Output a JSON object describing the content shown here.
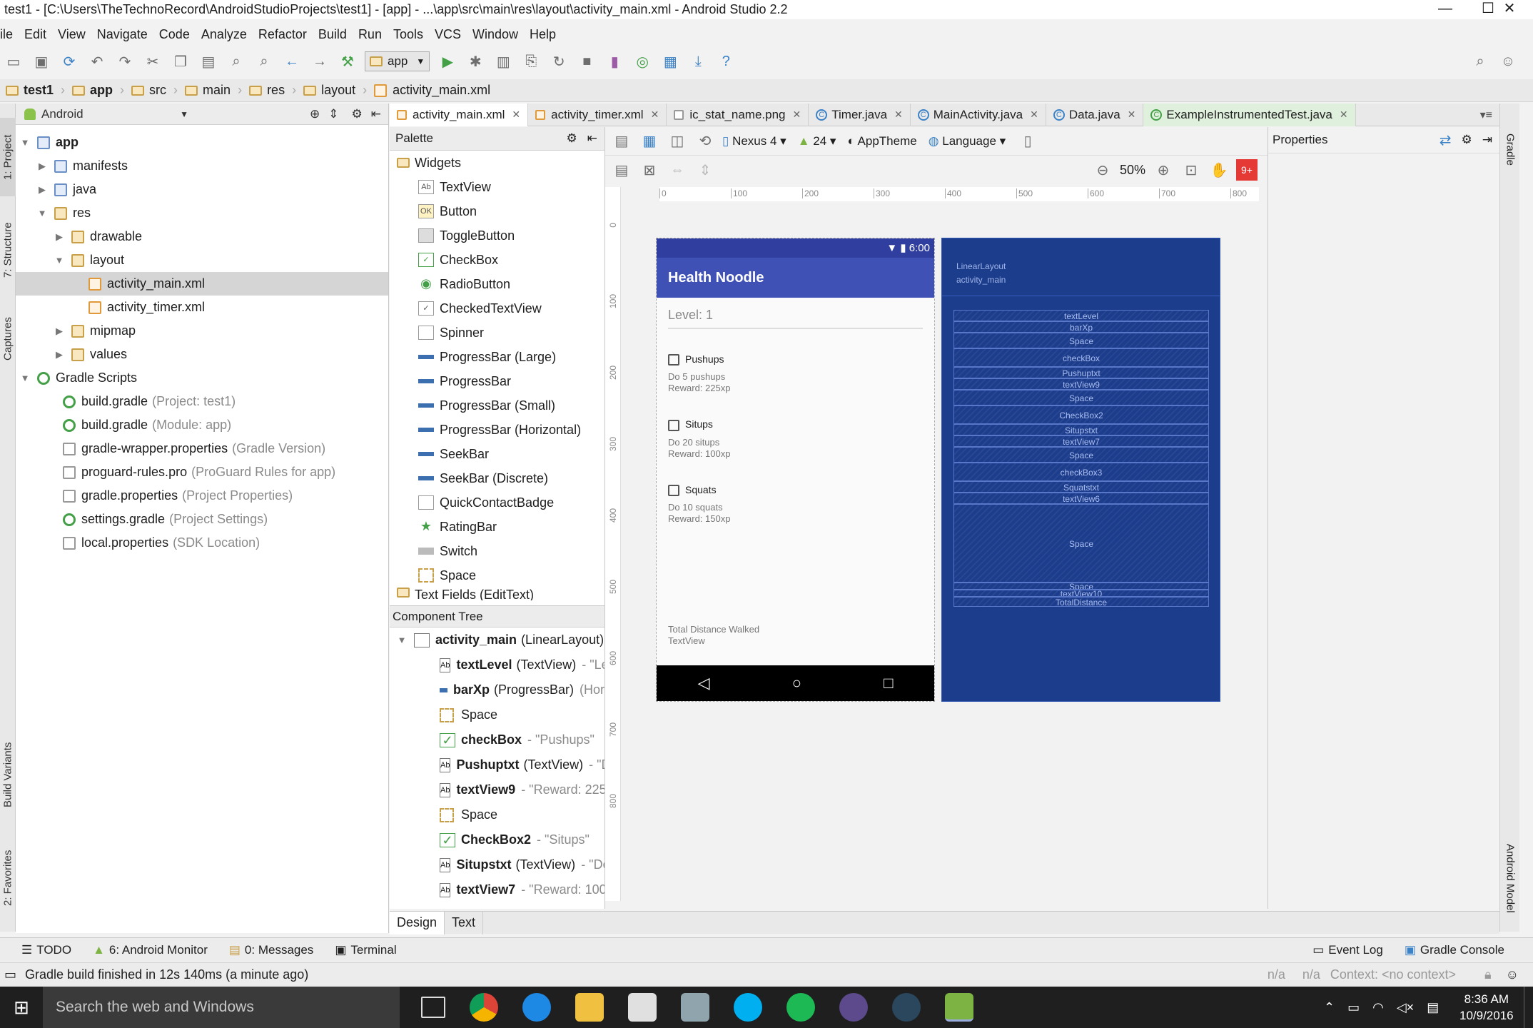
{
  "window": {
    "title": "test1 - [C:\\Users\\TheTechnoRecord\\AndroidStudioProjects\\test1] - [app] - ...\\app\\src\\main\\res\\layout\\activity_main.xml - Android Studio 2.2"
  },
  "menu": [
    "ile",
    "Edit",
    "View",
    "Navigate",
    "Code",
    "Analyze",
    "Refactor",
    "Build",
    "Run",
    "Tools",
    "VCS",
    "Window",
    "Help"
  ],
  "toolbar": {
    "run_config": "app"
  },
  "breadcrumbs": [
    "test1",
    "app",
    "src",
    "main",
    "res",
    "layout",
    "activity_main.xml"
  ],
  "left_tabs": [
    "1: Project",
    "7: Structure",
    "Captures",
    "Build Variants",
    "2: Favorites"
  ],
  "project": {
    "view_mode": "Android",
    "items": [
      {
        "label": "app",
        "extra": ""
      },
      {
        "label": "manifests",
        "extra": ""
      },
      {
        "label": "java",
        "extra": ""
      },
      {
        "label": "res",
        "extra": ""
      },
      {
        "label": "drawable",
        "extra": ""
      },
      {
        "label": "layout",
        "extra": ""
      },
      {
        "label": "activity_main.xml",
        "extra": ""
      },
      {
        "label": "activity_timer.xml",
        "extra": ""
      },
      {
        "label": "mipmap",
        "extra": ""
      },
      {
        "label": "values",
        "extra": ""
      },
      {
        "label": "Gradle Scripts",
        "extra": ""
      },
      {
        "label": "build.gradle",
        "extra": "(Project: test1)"
      },
      {
        "label": "build.gradle",
        "extra": "(Module: app)"
      },
      {
        "label": "gradle-wrapper.properties",
        "extra": "(Gradle Version)"
      },
      {
        "label": "proguard-rules.pro",
        "extra": "(ProGuard Rules for app)"
      },
      {
        "label": "gradle.properties",
        "extra": "(Project Properties)"
      },
      {
        "label": "settings.gradle",
        "extra": "(Project Settings)"
      },
      {
        "label": "local.properties",
        "extra": "(SDK Location)"
      }
    ]
  },
  "editor_tabs": [
    "activity_main.xml",
    "activity_timer.xml",
    "ic_stat_name.png",
    "Timer.java",
    "MainActivity.java",
    "Data.java",
    "ExampleInstrumentedTest.java"
  ],
  "palette": {
    "title": "Palette",
    "group": "Widgets",
    "items": [
      {
        "icon": "Ab",
        "label": "TextView"
      },
      {
        "icon": "OK",
        "label": "Button"
      },
      {
        "icon": "",
        "label": "ToggleButton"
      },
      {
        "icon": "✓",
        "label": "CheckBox"
      },
      {
        "icon": "◉",
        "label": "RadioButton"
      },
      {
        "icon": "✓",
        "label": "CheckedTextView"
      },
      {
        "icon": "",
        "label": "Spinner"
      },
      {
        "icon": "",
        "label": "ProgressBar (Large)"
      },
      {
        "icon": "",
        "label": "ProgressBar"
      },
      {
        "icon": "",
        "label": "ProgressBar (Small)"
      },
      {
        "icon": "",
        "label": "ProgressBar (Horizontal)"
      },
      {
        "icon": "",
        "label": "SeekBar"
      },
      {
        "icon": "",
        "label": "SeekBar (Discrete)"
      },
      {
        "icon": "",
        "label": "QuickContactBadge"
      },
      {
        "icon": "★",
        "label": "RatingBar"
      },
      {
        "icon": "",
        "label": "Switch"
      },
      {
        "icon": "",
        "label": "Space"
      }
    ],
    "next_group": "Text Fields (EditText)"
  },
  "component_tree": {
    "title": "Component Tree",
    "root": {
      "name": "activity_main",
      "type": "(LinearLayout)"
    },
    "items": [
      {
        "icon": "Ab",
        "name": "textLevel",
        "type": "(TextView)",
        "value": "- \"Le"
      },
      {
        "icon": "",
        "name": "barXp",
        "type": "(ProgressBar)",
        "value": "(Hor"
      },
      {
        "icon": "",
        "name": "",
        "type": "Space",
        "value": ""
      },
      {
        "icon": "✓",
        "name": "checkBox",
        "type": "",
        "value": "- \"Pushups\""
      },
      {
        "icon": "Ab",
        "name": "Pushuptxt",
        "type": "(TextView)",
        "value": "- \"D"
      },
      {
        "icon": "Ab",
        "name": "textView9",
        "type": "",
        "value": "- \"Reward: 225"
      },
      {
        "icon": "",
        "name": "",
        "type": "Space",
        "value": ""
      },
      {
        "icon": "✓",
        "name": "CheckBox2",
        "type": "",
        "value": "- \"Situps\""
      },
      {
        "icon": "Ab",
        "name": "Situpstxt",
        "type": "(TextView)",
        "value": "- \"Do"
      },
      {
        "icon": "Ab",
        "name": "textView7",
        "type": "",
        "value": "- \"Reward: 100"
      }
    ]
  },
  "design_toolbar": {
    "device": "Nexus 4",
    "api": "24",
    "theme": "AppTheme",
    "language": "Language",
    "zoom": "50%"
  },
  "ruler_h": [
    "0",
    "100",
    "200",
    "300",
    "400",
    "500",
    "600",
    "700",
    "800"
  ],
  "ruler_v": [
    "0",
    "100",
    "200",
    "300",
    "400",
    "500",
    "600",
    "700",
    "800"
  ],
  "preview": {
    "time": "6:00",
    "app_title": "Health Noodle",
    "level": "Level: 1",
    "tasks": [
      {
        "name": "Pushups",
        "desc": "Do 5 pushups",
        "reward": "Reward: 225xp"
      },
      {
        "name": "Situps",
        "desc": "Do 20 situps",
        "reward": "Reward: 100xp"
      },
      {
        "name": "Squats",
        "desc": "Do 10 squats",
        "reward": "Reward: 150xp"
      }
    ],
    "footer1": "Total Distance Walked",
    "footer2": "TextView"
  },
  "blueprint": {
    "header1": "LinearLayout",
    "header2": "activity_main",
    "boxes": [
      "textLevel",
      "barXp",
      "Space",
      "checkBox",
      "Pushuptxt",
      "textView9",
      "Space",
      "CheckBox2",
      "Situpstxt",
      "textView7",
      "Space",
      "checkBox3",
      "Squatstxt",
      "textView6",
      "Space",
      "Space",
      "textView10",
      "TotalDistance"
    ]
  },
  "properties": {
    "title": "Properties"
  },
  "right_tabs": [
    "Gradle",
    "Android Model"
  ],
  "design_tabs": [
    "Design",
    "Text"
  ],
  "bottom_tools": [
    "TODO",
    "6: Android Monitor",
    "0: Messages",
    "Terminal"
  ],
  "bottom_tools_right": [
    "Event Log",
    "Gradle Console"
  ],
  "status": {
    "message": "Gradle build finished in 12s 140ms (a minute ago)",
    "na1": "n/a",
    "na2": "n/a",
    "context": "Context: <no context>"
  },
  "taskbar": {
    "search": "Search the web and Windows",
    "time": "8:36 AM",
    "date": "10/9/2016"
  }
}
